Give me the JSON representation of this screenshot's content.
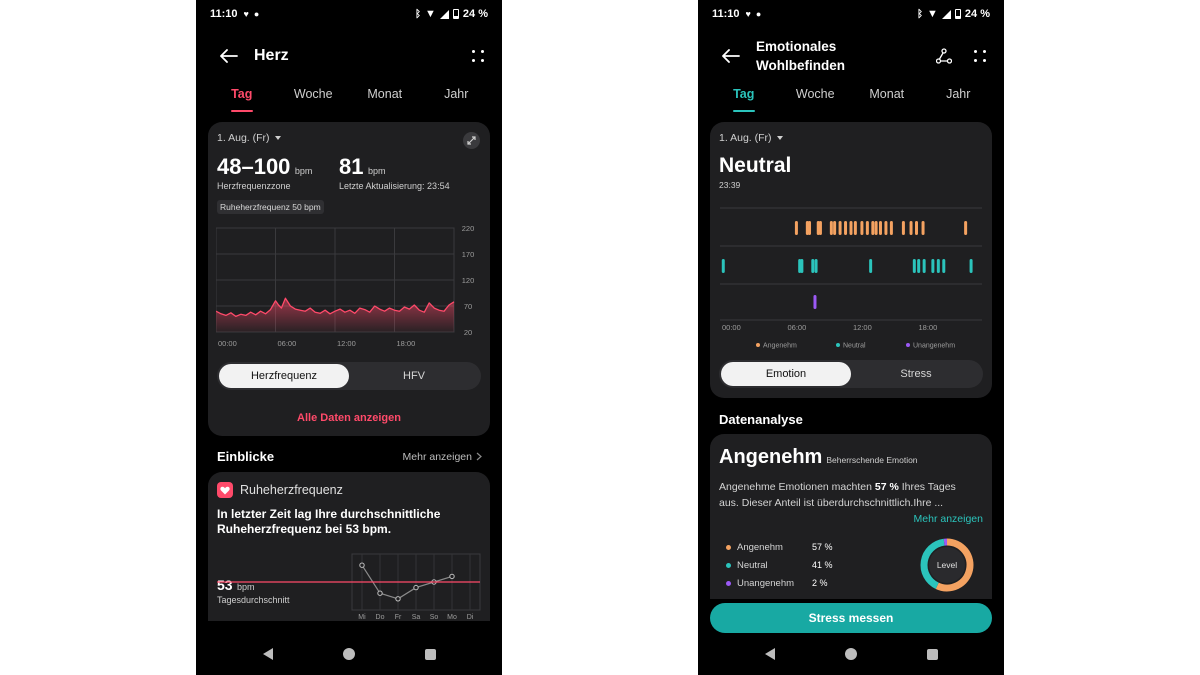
{
  "status": {
    "time": "11:10",
    "battery": "24 %"
  },
  "left": {
    "title": "Herz",
    "tabs": [
      "Tag",
      "Woche",
      "Monat",
      "Jahr"
    ],
    "active_tab": 0,
    "date": "1. Aug. (Fr)",
    "range_value": "48–100",
    "range_unit": "bpm",
    "range_label": "Herzfrequenzzone",
    "current_value": "81",
    "current_unit": "bpm",
    "current_label": "Letzte Aktualisierung: 23:54",
    "resting_badge": "Ruheherzfrequenz 50 bpm",
    "segment": [
      "Herzfrequenz",
      "HFV"
    ],
    "show_all": "Alle Daten anzeigen",
    "insights_title": "Einblicke",
    "more_link": "Mehr anzeigen",
    "insight_card_title": "Ruheherzfrequenz",
    "insight_text": "In letzter Zeit lag Ihre durchschnittliche Ruheherzfrequenz bei 53 bpm.",
    "avg_value": "53",
    "avg_unit": "bpm",
    "avg_label": "Tagesdurchschnitt"
  },
  "right": {
    "title_line1": "Emotionales",
    "title_line2": "Wohlbefinden",
    "tabs": [
      "Tag",
      "Woche",
      "Monat",
      "Jahr"
    ],
    "active_tab": 0,
    "date": "1. Aug. (Fr)",
    "emotion": "Neutral",
    "emotion_time": "23:39",
    "segment": [
      "Emotion",
      "Stress"
    ],
    "analysis_title": "Datenanalyse",
    "dominant": "Angenehm",
    "dominant_caption": "Beherrschende Emotion",
    "desc_pre": "Angenehme Emotionen machten ",
    "desc_bold": "57 %",
    "desc_post": " Ihres Tages aus. Dieser Anteil ist überdurchschnittlich.Ihre ...",
    "more_link": "Mehr anzeigen",
    "level_label": "Level",
    "measure_button": "Stress messen"
  },
  "colors": {
    "heart": "#ff4a6a",
    "pleasant": "#f4a261",
    "neutral": "#2bc4bc",
    "unpleasant": "#9b59f5",
    "card": "#1f1f21"
  },
  "chart_data": [
    {
      "type": "area",
      "title": "",
      "x_ticks": [
        "00:00",
        "06:00",
        "12:00",
        "18:00"
      ],
      "y_ticks": [
        220,
        170,
        120,
        70,
        20
      ],
      "ylim": [
        20,
        220
      ],
      "xlim": [
        0,
        24
      ],
      "grid": true,
      "series": [
        {
          "x": [
            0,
            0.5,
            1,
            1.5,
            2,
            2.5,
            3,
            3.5,
            4,
            4.5,
            5,
            5.5,
            6,
            6.3,
            6.6,
            7,
            7.5,
            8,
            8.5,
            9,
            9.5,
            10,
            10.5,
            11,
            11.5,
            12,
            12.5,
            13,
            13.5,
            14,
            14.5,
            15,
            15.5,
            16,
            16.5,
            17,
            17.5,
            18,
            18.5,
            19,
            19.5,
            20,
            20.5,
            21,
            21.5,
            22,
            22.5,
            23,
            23.5,
            24
          ],
          "y": [
            60,
            55,
            52,
            57,
            50,
            54,
            52,
            58,
            53,
            60,
            55,
            63,
            80,
            72,
            66,
            85,
            70,
            64,
            62,
            60,
            66,
            58,
            56,
            62,
            55,
            60,
            64,
            58,
            62,
            56,
            66,
            63,
            58,
            70,
            64,
            60,
            66,
            62,
            60,
            68,
            64,
            72,
            62,
            58,
            76,
            66,
            62,
            60,
            72,
            78
          ]
        }
      ]
    },
    {
      "type": "scatter",
      "x_ticks": [
        "00:00",
        "06:00",
        "12:00",
        "18:00"
      ],
      "xlim": [
        0,
        24
      ],
      "legend": "bottom",
      "series": [
        {
          "name": "Angenehm",
          "x": [
            7.0,
            8.0,
            8.2,
            9.0,
            9.2,
            10.2,
            10.5,
            11.0,
            11.5,
            12.0,
            12.4,
            13.0,
            13.5,
            14.0,
            14.3,
            14.7,
            15.2,
            15.7,
            16.8,
            17.5,
            18.0,
            18.6,
            22.5
          ]
        },
        {
          "name": "Neutral",
          "x": [
            0.3,
            7.3,
            7.5,
            8.5,
            8.8,
            13.8,
            17.8,
            18.2,
            18.7,
            19.5,
            20.0,
            20.5,
            23.0
          ]
        },
        {
          "name": "Unangenehm",
          "x": [
            8.7
          ]
        }
      ]
    },
    {
      "type": "line",
      "categories": [
        "Mi",
        "Do",
        "Fr",
        "Sa",
        "So",
        "Mo",
        "Di"
      ],
      "values": [
        56,
        51,
        50,
        52,
        53,
        54,
        null
      ],
      "reference_value": 53
    },
    {
      "type": "pie",
      "categories": [
        "Angenehm",
        "Neutral",
        "Unangenehm"
      ],
      "values": [
        57,
        41,
        2
      ],
      "labels": [
        "57 %",
        "41 %",
        "2 %"
      ]
    }
  ]
}
